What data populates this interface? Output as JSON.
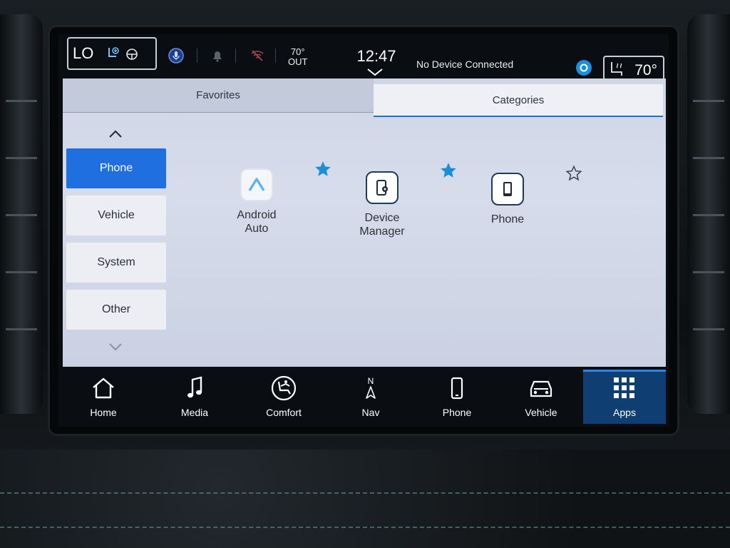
{
  "status_bar": {
    "climate_mode": "LO",
    "outside_temp": "70°",
    "outside_label": "OUT",
    "clock": "12:47",
    "device_status": "No Device Connected",
    "seat_temp": "70°"
  },
  "tabs": [
    {
      "label": "Favorites",
      "active": false
    },
    {
      "label": "Categories",
      "active": true
    }
  ],
  "categories": [
    {
      "label": "Phone",
      "active": true
    },
    {
      "label": "Vehicle",
      "active": false
    },
    {
      "label": "System",
      "active": false
    },
    {
      "label": "Other",
      "active": false
    }
  ],
  "apps": [
    {
      "label": "Android\nAuto",
      "icon": "android-auto-icon",
      "favorite": true
    },
    {
      "label": "Device\nManager",
      "icon": "device-manager-icon",
      "favorite": true
    },
    {
      "label": "Phone",
      "icon": "phone-icon",
      "favorite": false
    }
  ],
  "nav": [
    {
      "label": "Home",
      "icon": "home-icon",
      "active": false
    },
    {
      "label": "Media",
      "icon": "music-note-icon",
      "active": false
    },
    {
      "label": "Comfort",
      "icon": "seat-comfort-icon",
      "active": false
    },
    {
      "label": "Nav",
      "icon": "compass-icon",
      "compass_letter": "N",
      "active": false
    },
    {
      "label": "Phone",
      "icon": "phone-icon",
      "active": false
    },
    {
      "label": "Vehicle",
      "icon": "car-icon",
      "active": false
    },
    {
      "label": "Apps",
      "icon": "grid-icon",
      "active": true
    }
  ],
  "colors": {
    "accent": "#1f6fe0",
    "star": "#1a8fd6",
    "nav_active": "#0f3f72"
  }
}
